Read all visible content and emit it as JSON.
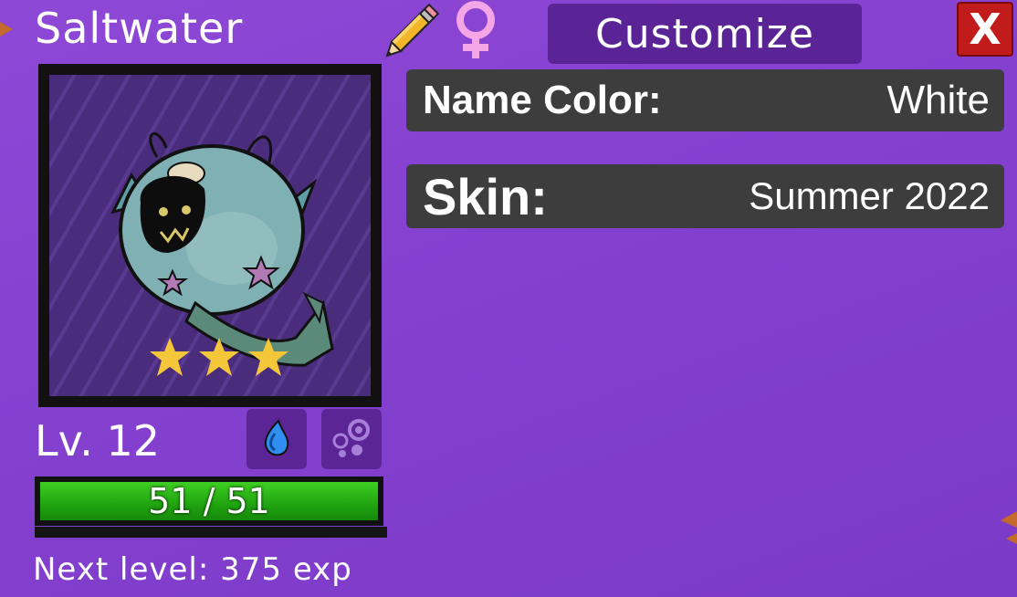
{
  "creature": {
    "name": "Saltwater",
    "stars": 3,
    "level_label": "Lv. 12",
    "hp_text": "51 / 51",
    "hp_current": 51,
    "hp_max": 51,
    "next_level_text": "Next level: 375 exp"
  },
  "header": {
    "customize_label": "Customize",
    "close_label": "X"
  },
  "info": {
    "name_color_label": "Name Color:",
    "name_color_value": "White",
    "skin_label": "Skin:",
    "skin_value": "Summer 2022"
  },
  "icons": {
    "edit": "pencil-icon",
    "gender": "female-icon",
    "type1": "water-drop-icon",
    "type2": "bubbles-icon",
    "close": "close-icon"
  },
  "colors": {
    "background": "#8a45d4",
    "button_purple": "#5a2496",
    "close_red": "#c21b1b",
    "row_gray": "#3d3d3d",
    "hp_green": "#20a310",
    "star_yellow": "#f4c63a",
    "gender_pink": "#f5a6e6"
  }
}
